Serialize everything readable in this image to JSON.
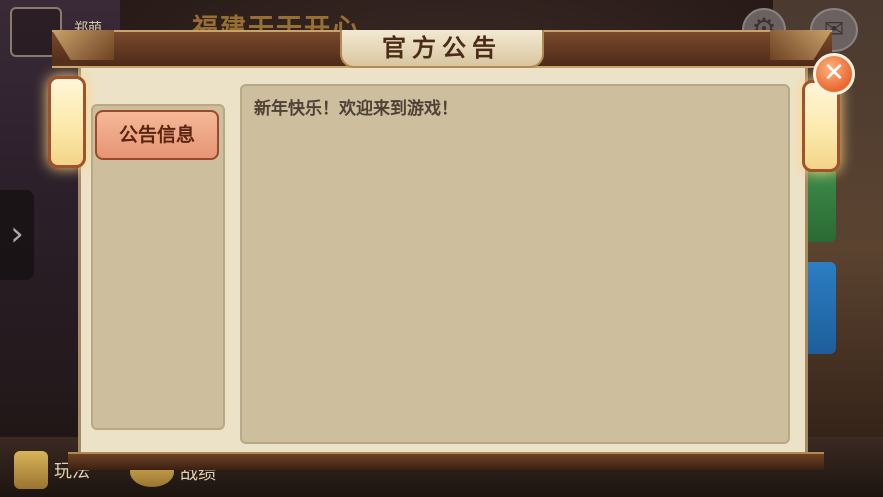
{
  "background": {
    "player_name": "郑萌",
    "game_title": "福建干干开心",
    "settings_icon": "gear-icon",
    "mail_icon": "mail-icon",
    "bottom_nav": {
      "rules_label": "玩法",
      "record_label": "战绩"
    }
  },
  "dialog": {
    "title": "官方公告",
    "close_icon": "close-icon",
    "tabs": [
      {
        "label": "公告信息",
        "selected": true
      }
    ],
    "content": "新年快乐！欢迎来到游戏！"
  },
  "colors": {
    "header_brown": "#5b331e",
    "panel_beige": "#cdbf9e",
    "tab_salmon": "#eda384",
    "close_orange": "#e8682e"
  }
}
